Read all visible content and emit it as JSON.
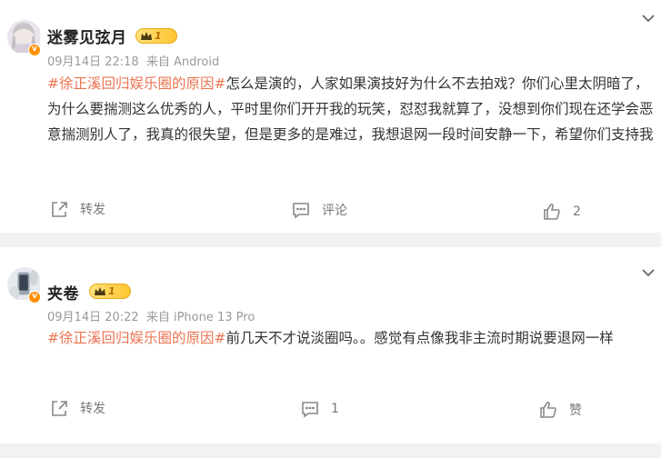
{
  "posts": [
    {
      "username": "迷雾见弦月",
      "level": "1",
      "date": "09月14日 22:18",
      "source": "来自 Android",
      "topic": "#徐正溪回归娱乐圈的原因#",
      "body": "怎么是演的，人家如果演技好为什么不去拍戏？你们心里太阴暗了，为什么要揣测这么优秀的人，平时里你们开开我的玩笑，怼怼我就算了，没想到你们现在还学会恶意揣测别人了，我真的很失望，但是更多的是难过，我想退网一段时间安静一下，希望你们支持我",
      "repost_label": "转发",
      "comment_label": "评论",
      "like_count": "2"
    },
    {
      "username": "夹卷",
      "level": "1",
      "date": "09月14日 20:22",
      "source": "来自 iPhone 13 Pro",
      "topic": "#徐正溪回归娱乐圈的原因#",
      "body": "前几天不才说淡圈吗。。感觉有点像我非主流时期说要退网一样",
      "repost_label": "转发",
      "comment_label": "1",
      "like_count": "赞"
    }
  ],
  "icons": {
    "verified": "v-badge",
    "repost": "share-arrow-icon",
    "comment": "comment-bubble-icon",
    "like": "thumbs-up-icon",
    "more": "chevron-down-icon"
  },
  "colors": {
    "topic": "#eb7350",
    "verified_badge": "#ff9000",
    "level_badge": "#ffc531",
    "meta_text": "#999999"
  }
}
